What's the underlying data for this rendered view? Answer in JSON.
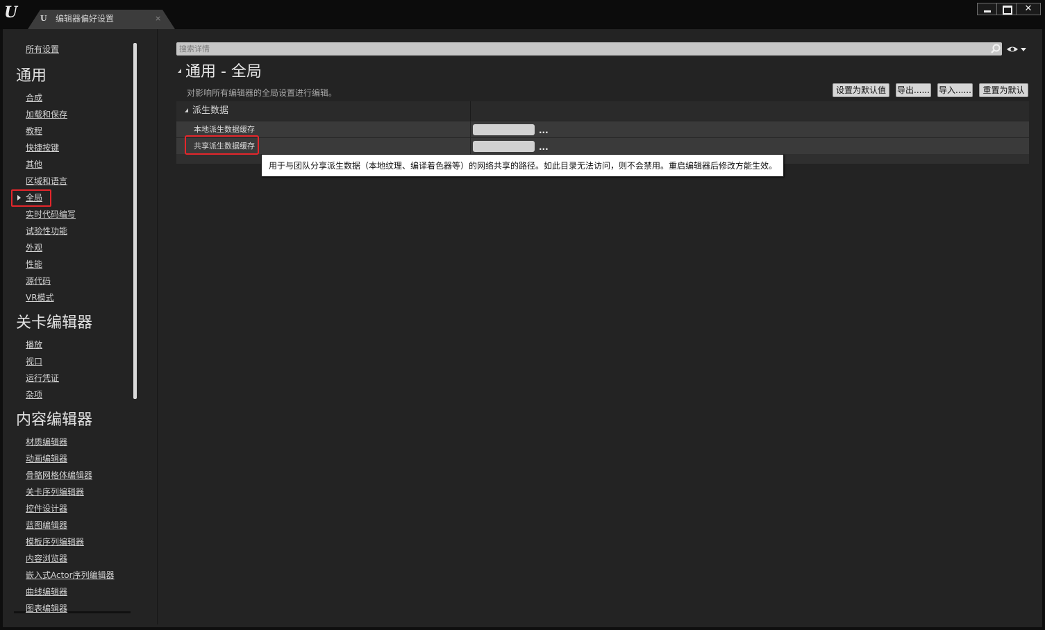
{
  "window": {
    "tab_title": "编辑器偏好设置",
    "tab_close": "×",
    "logo_text": "U",
    "tab_icon_text": "U"
  },
  "sidebar": {
    "all_settings": "所有设置",
    "groups": [
      {
        "title": "通用",
        "items": [
          "合成",
          "加载和保存",
          "教程",
          "快捷按键",
          "其他",
          "区域和语言",
          "全局",
          "实时代码编写",
          "试验性功能",
          "外观",
          "性能",
          "源代码",
          "VR模式"
        ]
      },
      {
        "title": "关卡编辑器",
        "items": [
          "播放",
          "视口",
          "运行凭证",
          "杂项"
        ]
      },
      {
        "title": "内容编辑器",
        "items": [
          "材质编辑器",
          "动画编辑器",
          "骨骼网格体编辑器",
          "关卡序列编辑器",
          "控件设计器",
          "蓝图编辑器",
          "模板序列编辑器",
          "内容浏览器",
          "嵌入式Actor序列编辑器",
          "曲线编辑器",
          "图表编辑器"
        ]
      }
    ],
    "selected_item": "全局"
  },
  "search": {
    "placeholder": "搜索详情",
    "value": ""
  },
  "section": {
    "title": "通用 - 全局",
    "description": "对影响所有编辑器的全局设置进行编辑。"
  },
  "actions": {
    "set_default": "设置为默认值",
    "export": "导出......",
    "import": "导入......",
    "reset_default": "重置为默认"
  },
  "category": {
    "title": "派生数据",
    "properties": [
      {
        "label": "本地派生数据缓存",
        "value": "",
        "browse": "..."
      },
      {
        "label": "共享派生数据缓存",
        "value": "",
        "browse": "..."
      }
    ]
  },
  "tooltip": {
    "text": "用于与团队分享派生数据（本地纹理、编译着色器等）的网络共享的路径。如此目录无法访问，则不会禁用。重启编辑器后修改方能生效。"
  },
  "colors": {
    "highlight": "#e4262b",
    "panel": "#232323",
    "titlebar": "#0c0c0c"
  }
}
